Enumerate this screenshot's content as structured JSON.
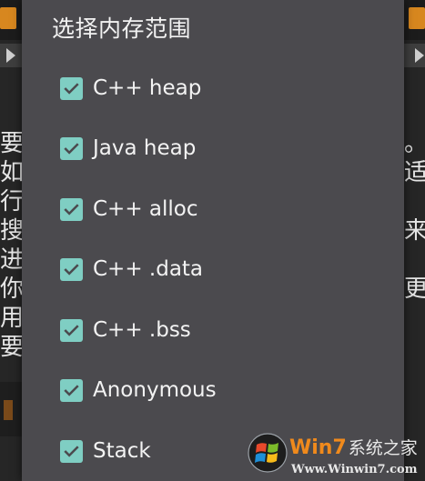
{
  "background": {
    "left_text": [
      "要",
      "如",
      "行",
      "搜",
      "进",
      "你",
      "用",
      "要"
    ],
    "right_text": [
      "。",
      "适",
      "",
      "来",
      "",
      "更",
      "",
      ""
    ]
  },
  "dialog": {
    "title": "选择内存范围",
    "options": [
      {
        "label": "C++ heap",
        "checked": true
      },
      {
        "label": "Java heap",
        "checked": true
      },
      {
        "label": "C++ alloc",
        "checked": true
      },
      {
        "label": "C++ .data",
        "checked": true
      },
      {
        "label": "C++ .bss",
        "checked": true
      },
      {
        "label": "Anonymous",
        "checked": true
      },
      {
        "label": "Stack",
        "checked": true
      }
    ]
  },
  "watermark": {
    "title_part1": "Win7",
    "title_part2": "系统之家",
    "url": "Www.Winwin7.com"
  },
  "colors": {
    "dialog_bg": "#4b4a4e",
    "checkbox": "#7fcec3",
    "text": "#f3f3f3"
  }
}
